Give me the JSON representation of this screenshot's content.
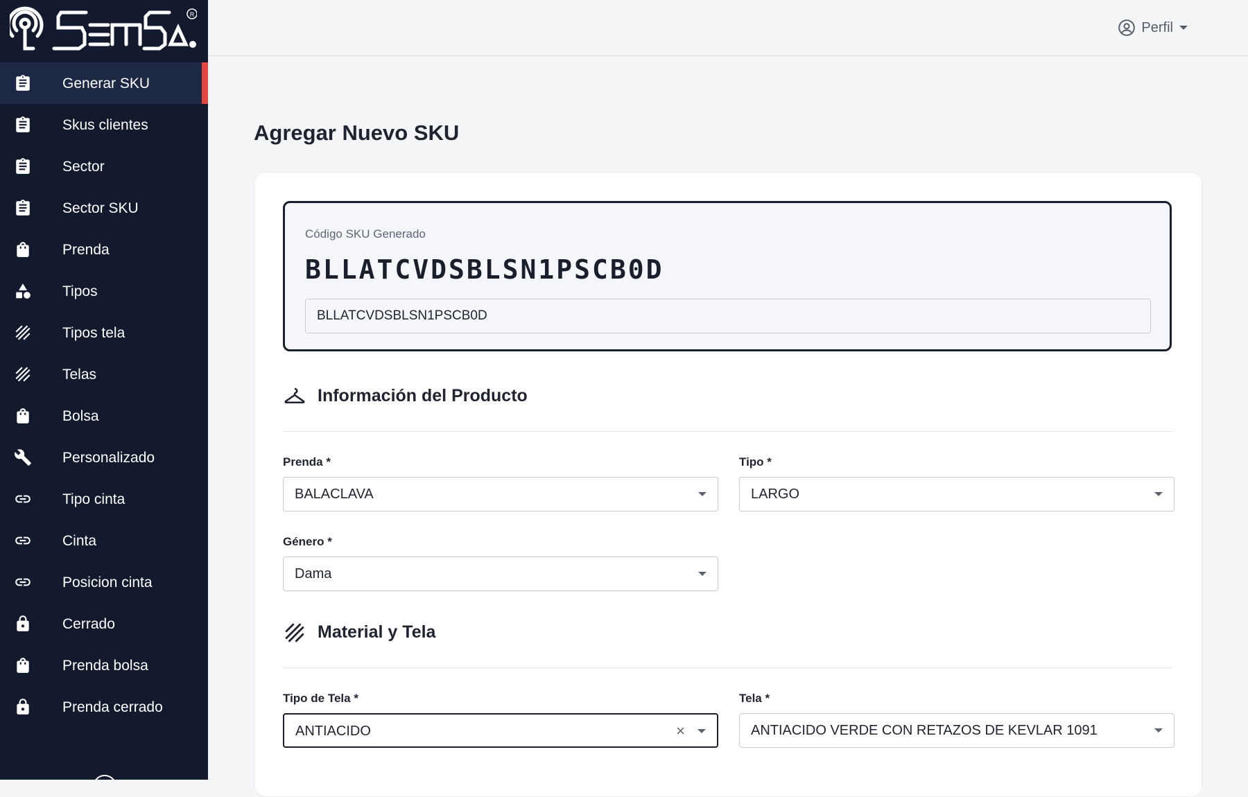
{
  "brand": {
    "logo_text": "SEMSA",
    "accent_color": "#e2463f",
    "sidebar_color": "#131a2e"
  },
  "sidebar": {
    "items": [
      {
        "label": "Generar SKU",
        "icon": "clipboard-icon",
        "active": true
      },
      {
        "label": "Skus clientes",
        "icon": "clipboard-icon"
      },
      {
        "label": "Sector",
        "icon": "clipboard-icon"
      },
      {
        "label": "Sector SKU",
        "icon": "clipboard-icon"
      },
      {
        "label": "Prenda",
        "icon": "bag-icon"
      },
      {
        "label": "Tipos",
        "icon": "shapes-icon"
      },
      {
        "label": "Tipos tela",
        "icon": "texture-icon"
      },
      {
        "label": "Telas",
        "icon": "texture-icon"
      },
      {
        "label": "Bolsa",
        "icon": "bag-icon"
      },
      {
        "label": "Personalizado",
        "icon": "wrench-icon"
      },
      {
        "label": "Tipo cinta",
        "icon": "link-icon"
      },
      {
        "label": "Cinta",
        "icon": "link-icon"
      },
      {
        "label": "Posicion cinta",
        "icon": "link-icon"
      },
      {
        "label": "Cerrado",
        "icon": "lock-icon"
      },
      {
        "label": "Prenda bolsa",
        "icon": "bag-icon"
      },
      {
        "label": "Prenda cerrado",
        "icon": "lock-icon"
      }
    ]
  },
  "topbar": {
    "profile_label": "Perfil",
    "profile_icon": "user-circle-icon"
  },
  "main": {
    "title": "Agregar Nuevo SKU",
    "sku": {
      "caption": "Código SKU Generado",
      "code": "BLLATCVDSBLSN1PSCB0D",
      "input_value": "BLLATCVDSBLSN1PSCB0D"
    },
    "sections": {
      "product": {
        "title": "Información del Producto",
        "icon": "hanger-icon",
        "fields": {
          "prenda": {
            "label": "Prenda *",
            "value": "BALACLAVA"
          },
          "tipo": {
            "label": "Tipo *",
            "value": "LARGO"
          },
          "genero": {
            "label": "Género *",
            "value": "Dama"
          }
        }
      },
      "material": {
        "title": "Material y Tela",
        "icon": "texture-icon",
        "fields": {
          "tipo_tela": {
            "label": "Tipo de Tela *",
            "value": "ANTIACIDO"
          },
          "tela": {
            "label": "Tela *",
            "value": "ANTIACIDO VERDE CON RETAZOS DE KEVLAR 1091"
          }
        }
      }
    }
  }
}
